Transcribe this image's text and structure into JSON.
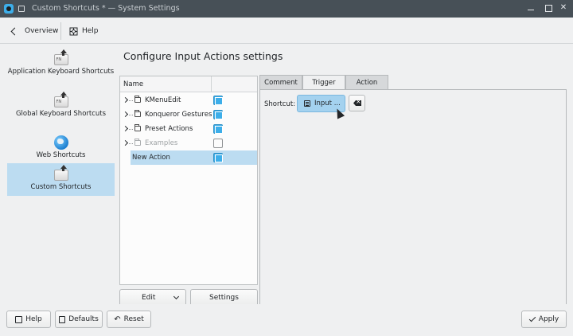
{
  "window": {
    "title": "Custom Shortcuts * — System Settings",
    "close_glyph": "✕",
    "icons": [
      "app-icon",
      "pin-icon",
      "minimize-icon",
      "maximize-icon",
      "close-icon"
    ]
  },
  "toolbar": {
    "overview_label": "Overview",
    "help_label": "Help"
  },
  "sidebar": {
    "items": [
      {
        "label": "Application Keyboard Shortcuts",
        "icon": "keyboard-key-icon",
        "key_text": "FN",
        "selected": false
      },
      {
        "label": "Global Keyboard Shortcuts",
        "icon": "keyboard-key-icon",
        "key_text": "FN",
        "selected": false
      },
      {
        "label": "Web Shortcuts",
        "icon": "globe-icon",
        "selected": false
      },
      {
        "label": "Custom Shortcuts",
        "icon": "keyboard-key-icon",
        "selected": true
      }
    ]
  },
  "main": {
    "title": "Configure Input Actions settings",
    "tree": {
      "column_name": "Name",
      "rows": [
        {
          "label": "KMenuEdit",
          "enabled": true,
          "folder": true
        },
        {
          "label": "Konqueror Gestures",
          "enabled": true,
          "folder": true
        },
        {
          "label": "Preset Actions",
          "enabled": true,
          "folder": true
        },
        {
          "label": "Examples",
          "enabled": false,
          "folder": true
        },
        {
          "label": "New Action",
          "enabled": true,
          "folder": false,
          "selected": true
        }
      ]
    },
    "edit_label": "Edit",
    "settings_label": "Settings",
    "tabs": [
      {
        "label": "Comment",
        "active": false
      },
      {
        "label": "Trigger",
        "active": true
      },
      {
        "label": "Action",
        "active": false
      }
    ],
    "trigger": {
      "shortcut_label": "Shortcut:",
      "input_label": "Input ..."
    }
  },
  "footer": {
    "help_label": "Help",
    "defaults_label": "Defaults",
    "reset_label": "Reset",
    "reset_glyph": "↶",
    "apply_label": "Apply"
  },
  "colors": {
    "accent": "#3daee9",
    "selection": "#bcdcf1",
    "titlebar": "#475057"
  }
}
